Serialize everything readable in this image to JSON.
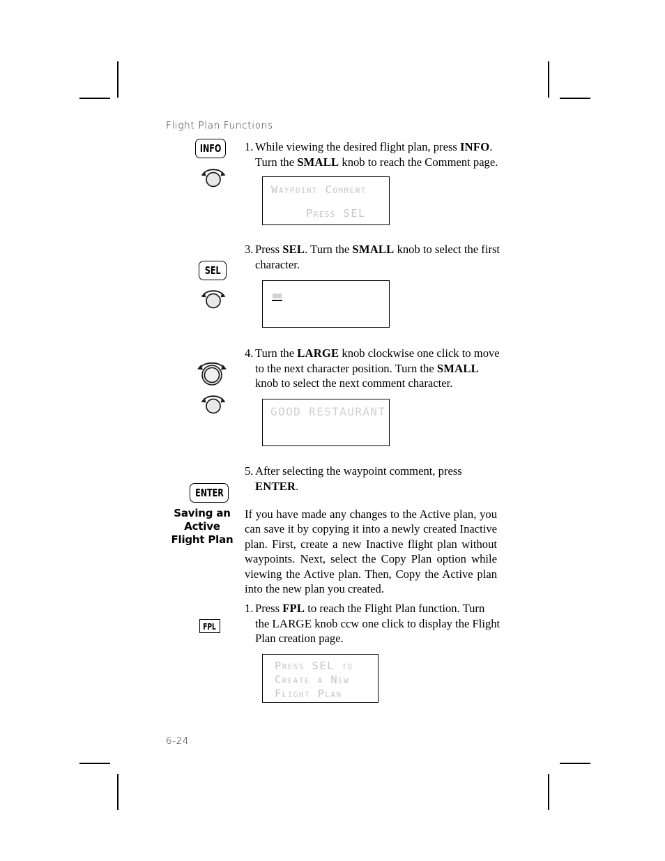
{
  "document": {
    "running_head": "Flight Plan Functions",
    "folio": "6-24"
  },
  "steps": [
    {
      "number": "1.",
      "text_parts": [
        {
          "t": "While viewing the desired flight plan, press ",
          "style": "normal"
        },
        {
          "t": "INFO",
          "style": "smallcaps-bold"
        },
        {
          "t": ". Turn the ",
          "style": "normal"
        },
        {
          "t": "SMALL",
          "style": "smallcaps-bold"
        },
        {
          "t": " knob to reach the Comment page.",
          "style": "normal"
        }
      ],
      "text_plain": "While viewing the desired flight plan, press INFO. Turn the SMALL knob to reach the Comment page."
    },
    {
      "number": "3.",
      "text_plain": "Press SEL. Turn the SMALL knob to select the first character."
    },
    {
      "number": "4.",
      "text_plain": "Turn the LARGE knob clockwise one click to move to the next character position. Turn the SMALL knob to select the next comment character."
    },
    {
      "number": "5.",
      "text_plain": "After selecting the waypoint comment, press ENTER."
    },
    {
      "number": "1.",
      "text_plain": "Press FPL to reach the Flight Plan function. Turn the LARGE knob ccw one click to display the Flight Plan creation page."
    }
  ],
  "step1": {
    "number": "1.",
    "line1_a": "While viewing the desired flight plan, press ",
    "line1_b": "INFO",
    "line1_c": ".",
    "line2_a": "Turn the ",
    "line2_b": "SMALL",
    "line2_c": " knob to reach the Comment page."
  },
  "step3": {
    "number": "3.",
    "line1_a": "Press ",
    "line1_b": "SEL",
    "line1_c": ". Turn the ",
    "line1_d": "SMALL",
    "line1_e": " knob to select the first",
    "line2": "character."
  },
  "step4": {
    "number": "4.",
    "line1_a": "Turn the ",
    "line1_b": "LARGE",
    "line1_c": " knob clockwise one click to move",
    "line2_a": "to the next character position. Turn the ",
    "line2_b": "SMALL",
    "line3": "knob to select the next comment character."
  },
  "step5": {
    "number": "5.",
    "line1": "After selecting the waypoint comment, press",
    "line2_b": "ENTER",
    "line2_c": "."
  },
  "step6": {
    "number": "1.",
    "line1_a": "Press ",
    "line1_b": "FPL",
    "line1_c": " to reach the Flight Plan function. Turn",
    "line2_a": "the ",
    "line2_b": "LARGE",
    "line2_c": " knob ccw one click to display the Flight",
    "line3": "Plan creation page."
  },
  "section": {
    "heading_line1": "Saving an",
    "heading_line2": "Active",
    "heading_line3": "Flight Plan",
    "heading_plain": "Saving an Active Flight Plan",
    "paragraph": "If you have made any changes to the Active plan, you can save it by copying it into a newly created Inactive plan. First, create a new Inactive flight plan without waypoints. Next, select the Copy Plan option while viewing the Active plan. Then, Copy the Active plan into the new plan you created."
  },
  "buttons": [
    {
      "id": "info",
      "label": "INFO",
      "shape": "rounded"
    },
    {
      "id": "sel",
      "label": "SEL",
      "shape": "rounded"
    },
    {
      "id": "enter",
      "label": "ENTER",
      "shape": "rounded"
    },
    {
      "id": "fpl",
      "label": "FPL",
      "shape": "square"
    }
  ],
  "button_info": {
    "label": "INFO"
  },
  "button_sel": {
    "label": "SEL"
  },
  "button_enter": {
    "label": "ENTER"
  },
  "button_fpl": {
    "label": "FPL"
  },
  "knobs": [
    {
      "id": "small-knob-1",
      "type": "small"
    },
    {
      "id": "small-knob-2",
      "type": "small"
    },
    {
      "id": "large-knob-1",
      "type": "large"
    },
    {
      "id": "small-knob-3",
      "type": "small"
    }
  ],
  "lcd_screens": [
    {
      "id": "lcd-waypoint-comment",
      "lines": [
        "Waypoint Comment",
        "",
        "Press SEL"
      ]
    },
    {
      "id": "lcd-first-character",
      "lines": [
        ""
      ],
      "has_cursor": true
    },
    {
      "id": "lcd-good-restaurant",
      "lines": [
        "GOOD RESTAURANT"
      ]
    },
    {
      "id": "lcd-create-new-plan",
      "lines": [
        "Press SEL to",
        "Create a New",
        "Flight Plan"
      ]
    }
  ],
  "lcd1": {
    "line1": "Waypoint Comment",
    "line2": "Press SEL"
  },
  "lcd3": {
    "line1": "GOOD RESTAURANT"
  },
  "lcd4": {
    "line1": "Press SEL to",
    "line2": "Create a New",
    "line3": "Flight Plan"
  },
  "colors": {
    "lcd_text": "#c6c6c6",
    "ink": "#000000",
    "head_gray": "#2b2b2b"
  }
}
